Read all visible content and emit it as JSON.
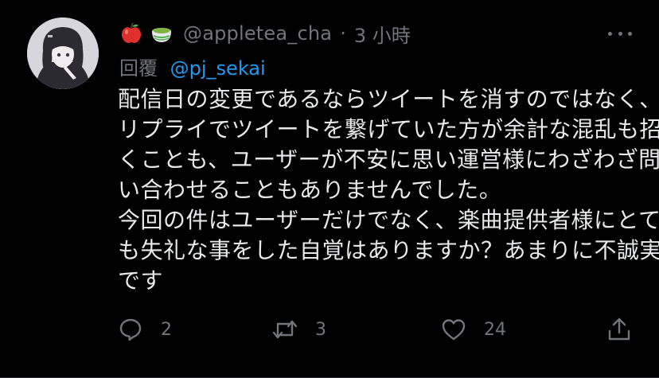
{
  "tweet": {
    "avatar_icon": "anime-character-avatar",
    "badges": [
      "apple-emoji",
      "green-tea-emoji"
    ],
    "handle": "@appletea_cha",
    "separator": "·",
    "time": "3 小時",
    "reply_label": "回覆",
    "reply_target": "@pj_sekai",
    "body_lines": [
      "配信日の変更であるならツイートを消すのではなく、",
      "リプライでツイートを繋げていた方が余計な混乱も招",
      "くことも、ユーザーが不安に思い運営様にわざわざ問",
      "い合わせることもありませんでした。",
      "今回の件はユーザーだけでなく、楽曲提供者様にとて",
      "も失礼な事をした自覚はありますか？あまりに不誠実",
      "です"
    ],
    "actions": {
      "reply_count": "2",
      "retweet_count": "3",
      "like_count": "24"
    }
  },
  "colors": {
    "background": "#000000",
    "text": "#e7e9ea",
    "muted": "#71767b",
    "link": "#1d9bf0"
  }
}
